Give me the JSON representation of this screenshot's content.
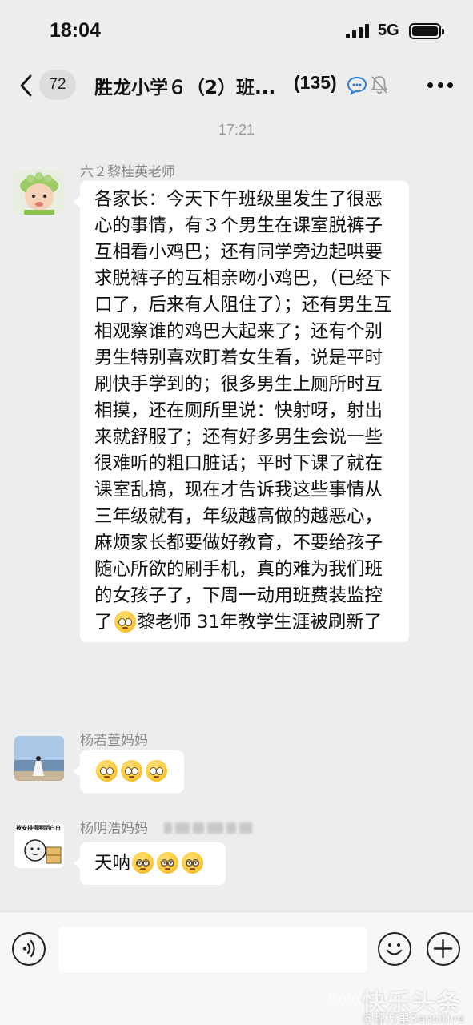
{
  "status_bar": {
    "time": "18:04",
    "network": "5G"
  },
  "nav": {
    "unread_count": "72",
    "title": "胜龙小学６（2）班...",
    "member_count": "(135)"
  },
  "timestamp": "17:21",
  "messages": [
    {
      "sender": "六２黎桂英老师",
      "text_main": "各家长：今天下午班级里发生了很恶心的事情，有３个男生在课室脱裤子互相看小鸡巴；还有同学旁边起哄要求脱裤子的互相亲吻小鸡巴，（已经下口了，后来有人阻住了）；还有男生互相观察谁的鸡巴大起来了；还有个别男生特别喜欢盯着女生看，说是平时刷快手学到的；很多男生上厕所时互相摸，还在厕所里说：快射呀，射出来就舒服了；还有好多男生会说一些很难听的粗口脏话；平时下课了就在课室乱搞，现在才告诉我这些事情从三年级就有，年级越高做的越恶心，麻烦家长都要做好教育，不要给孩子随心所欲的刷手机，真的难为我们班的女孩子了，下周一动用班费装监控了",
      "text_tail": "黎老师 31年教学生涯被刷新了"
    },
    {
      "sender": "杨若萱妈妈",
      "emoji_count": 3
    },
    {
      "sender": "杨明浩妈妈",
      "text": "天呐",
      "avatar_caption": "被安排得明明白白"
    }
  ],
  "watermark": {
    "logo": "快乐头条",
    "prefix": "Bolo",
    "account": "@那万里Sensitive"
  },
  "icons": {
    "back": "chevron-left-icon",
    "group": "group-chat-icon",
    "mute": "bell-off-icon",
    "more": "more-dots-icon",
    "voice": "voice-icon",
    "emoji": "emoji-icon",
    "plus": "plus-icon"
  }
}
